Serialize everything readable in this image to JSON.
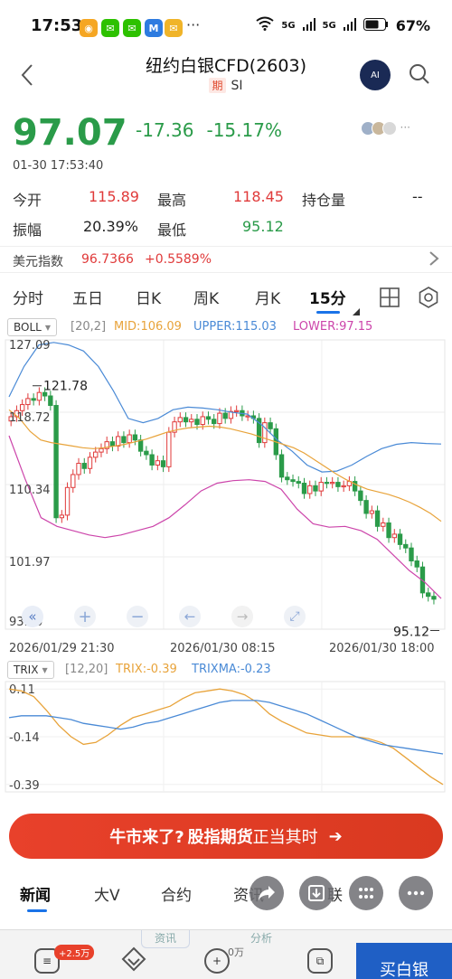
{
  "status_bar": {
    "time": "17:53",
    "app_icons": [
      "weibo-icon",
      "wechat-icon",
      "wechat-icon",
      "mail-app-icon",
      "mail-icon"
    ],
    "more": "···",
    "signal_1": "5G",
    "signal_2": "5G",
    "battery": "67%"
  },
  "header": {
    "title": "纽约白银CFD(2603)",
    "badge": "期",
    "code": "SI",
    "ai_label": "AI"
  },
  "quote": {
    "price": "97.07",
    "change": "-17.36",
    "change_pct": "-15.17%",
    "time": "01-30 17:53:40",
    "open_label": "今开",
    "open": "115.89",
    "high_label": "最高",
    "high": "118.45",
    "oi_label": "持仓量",
    "oi": "--",
    "amp_label": "振幅",
    "amp": "20.39%",
    "low_label": "最低",
    "low": "95.12"
  },
  "usd_index": {
    "label": "美元指数",
    "value": "96.7366",
    "change_pct": "+0.5589%"
  },
  "period_tabs": [
    "分时",
    "五日",
    "日K",
    "周K",
    "月K",
    "15分"
  ],
  "active_tab": "15分",
  "boll": {
    "name": "BOLL",
    "params": "[20,2]",
    "mid": "MID:106.09",
    "upper": "UPPER:115.03",
    "lower": "LOWER:97.15"
  },
  "trix": {
    "name": "TRIX",
    "params": "[12,20]",
    "trix": "TRIX:-0.39",
    "trixma": "TRIXMA:-0.23"
  },
  "chart_controls": [
    "«",
    "+",
    "−",
    "←",
    "→",
    "⤢"
  ],
  "chart_data": [
    {
      "type": "candlestick",
      "title": "",
      "y_ticks": [
        "127.09",
        "118.72",
        "110.34",
        "101.97",
        "93.60"
      ],
      "ylim": [
        93.6,
        127.09
      ],
      "x_ticks": [
        "2026/01/29 21:30",
        "2026/01/30 08:15",
        "2026/01/30 18:00"
      ],
      "annotations": {
        "max": "121.78",
        "min": "95.12"
      },
      "grid": true,
      "colors": {
        "up": "#e03a3a",
        "down": "#2a9b49",
        "mid": "#e8a33a",
        "upper": "#4a8ad6",
        "lower": "#cc44aa"
      },
      "closes": [
        118.2,
        118.9,
        119.6,
        120.3,
        120.1,
        121.0,
        120.6,
        119.5,
        106.5,
        106.8,
        110.0,
        111.5,
        112.8,
        112.2,
        113.5,
        114.1,
        114.5,
        115.3,
        114.8,
        115.9,
        115.2,
        116.1,
        115.5,
        114.2,
        113.8,
        112.6,
        113.1,
        112.4,
        116.4,
        117.6,
        118.1,
        117.6,
        117.9,
        117.3,
        118.2,
        117.9,
        117.4,
        118.6,
        118.0,
        118.8,
        118.9,
        118.3,
        118.3,
        118.0,
        115.2,
        117.5,
        116.8,
        113.8,
        111.2,
        110.9,
        110.7,
        110.5,
        109.3,
        110.2,
        109.6,
        110.6,
        110.5,
        110.6,
        110.1,
        110.2,
        110.7,
        109.6,
        108.5,
        107.0,
        107.3,
        105.5,
        105.9,
        104.2,
        104.6,
        103.4,
        103.0,
        101.5,
        100.8,
        97.8,
        97.4,
        97.07
      ],
      "boll_mid": [
        119.0,
        118.0,
        116.5,
        115.5,
        115.2,
        115.0,
        114.8,
        114.6,
        114.5,
        114.6,
        114.8,
        115.0,
        115.3,
        115.6,
        116.0,
        116.4,
        116.7,
        116.9,
        117.0,
        117.1,
        117.0,
        116.8,
        116.5,
        116.2,
        115.8,
        115.4,
        115.0,
        114.6,
        114.0,
        113.2,
        112.4,
        111.6,
        110.9,
        110.3,
        109.8,
        109.5,
        109.2,
        108.8,
        108.3,
        107.7,
        107.0,
        106.09
      ],
      "boll_upper": [
        120.5,
        124.0,
        126.5,
        126.8,
        126.5,
        125.8,
        124.0,
        121.2,
        118.0,
        117.5,
        118.0,
        119.0,
        119.3,
        119.2,
        119.0,
        118.7,
        118.5,
        117.2,
        115.5,
        114.2,
        112.6,
        111.8,
        111.9,
        112.6,
        113.6,
        114.5,
        115.0,
        115.2,
        115.1,
        115.03
      ],
      "boll_lower": [
        116.0,
        111.0,
        106.5,
        105.5,
        105.0,
        104.5,
        104.2,
        104.5,
        105.0,
        105.5,
        106.5,
        108.0,
        109.6,
        110.5,
        110.8,
        110.9,
        110.7,
        109.8,
        107.5,
        105.8,
        105.4,
        105.5,
        105.0,
        104.0,
        102.2,
        100.4,
        99.0,
        97.15
      ]
    },
    {
      "type": "line",
      "title": "",
      "y_ticks": [
        "0.11",
        "-0.14",
        "-0.39"
      ],
      "ylim": [
        -0.41,
        0.13
      ],
      "series": [
        {
          "name": "TRIX",
          "color": "#e8a33a",
          "values": [
            0.11,
            0.1,
            0.07,
            0.0,
            -0.08,
            -0.14,
            -0.18,
            -0.17,
            -0.13,
            -0.08,
            -0.04,
            -0.02,
            0.0,
            0.02,
            0.06,
            0.09,
            0.1,
            0.11,
            0.1,
            0.08,
            0.04,
            -0.02,
            -0.06,
            -0.09,
            -0.12,
            -0.13,
            -0.14,
            -0.14,
            -0.14,
            -0.15,
            -0.17,
            -0.2,
            -0.25,
            -0.3,
            -0.35,
            -0.39
          ]
        },
        {
          "name": "TRIXMA",
          "color": "#4a8ad6",
          "values": [
            -0.04,
            -0.03,
            -0.03,
            -0.03,
            -0.04,
            -0.05,
            -0.07,
            -0.08,
            -0.09,
            -0.1,
            -0.09,
            -0.07,
            -0.06,
            -0.04,
            -0.02,
            0.0,
            0.02,
            0.04,
            0.05,
            0.05,
            0.05,
            0.04,
            0.02,
            0.0,
            -0.02,
            -0.05,
            -0.08,
            -0.11,
            -0.14,
            -0.16,
            -0.18,
            -0.19,
            -0.2,
            -0.21,
            -0.22,
            -0.23
          ]
        }
      ]
    }
  ],
  "banner": {
    "part1": "牛市来了?",
    "part2": "股指期货",
    "part3": "正当其时",
    "arrow": "➔"
  },
  "news_tabs": [
    "新闻",
    "大V",
    "合约",
    "资讯",
    "联"
  ],
  "bottom_bar": {
    "badge1": "+2.5万",
    "badge2": "0万",
    "ghost_tab1": "资讯",
    "ghost_tab2": "分析",
    "buy": "买白银"
  }
}
